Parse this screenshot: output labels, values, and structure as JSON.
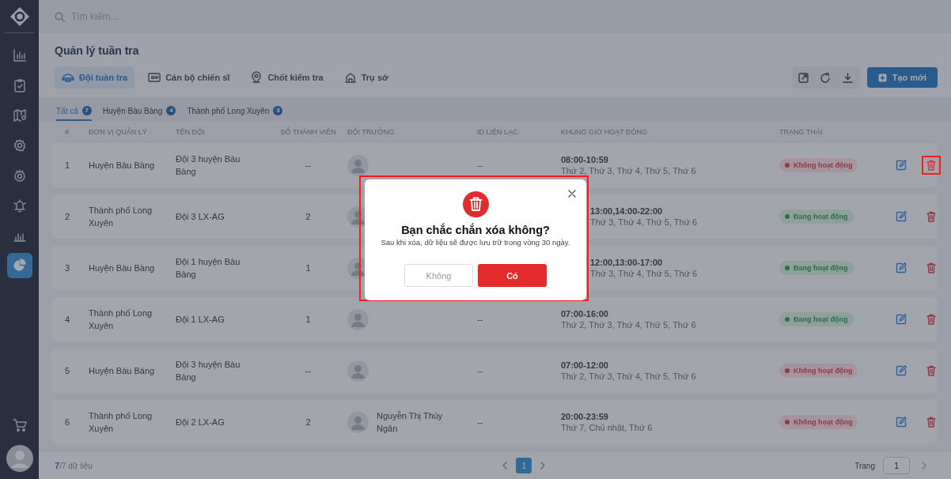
{
  "sidebar": {
    "items": [
      {
        "selected": false
      },
      {
        "selected": false
      },
      {
        "selected": false
      },
      {
        "selected": false
      },
      {
        "selected": false
      },
      {
        "selected": false
      },
      {
        "selected": false
      },
      {
        "selected": true
      }
    ]
  },
  "search": {
    "placeholder": "Tìm kiếm..."
  },
  "page_title": "Quản lý tuần tra",
  "tabs": [
    {
      "label": "Đội tuần tra",
      "selected": true
    },
    {
      "label": "Cán bộ chiến sĩ",
      "selected": false
    },
    {
      "label": "Chốt kiểm tra",
      "selected": false
    },
    {
      "label": "Trụ sở",
      "selected": false
    }
  ],
  "create_button": "Tạo mới",
  "filters": [
    {
      "label": "Tất cả",
      "count": "7",
      "selected": true
    },
    {
      "label": "Huyện Bàu Bàng",
      "count": "4",
      "selected": false
    },
    {
      "label": "Thành phố Long Xuyên",
      "count": "3",
      "selected": false
    }
  ],
  "table": {
    "columns": [
      "#",
      "ĐƠN VỊ QUẢN LÝ",
      "TÊN ĐỘI",
      "SỐ THÀNH VIÊN",
      "ĐỘI TRƯỞNG",
      "ID LIÊN LẠC",
      "KHUNG GIỜ HOẠT ĐỘNG",
      "TRẠNG THÁI"
    ],
    "rows": [
      {
        "index": "1",
        "unit": "Huyện Bàu Bàng",
        "team": "Đội 3 huyện Bàu Bàng",
        "members": "--",
        "contact_id": "--",
        "hours": "08:00-10:59",
        "days": "Thứ 2, Thứ 3, Thứ 4, Thứ 5, Thứ 6",
        "status": "Không hoạt động",
        "active": false,
        "delete_highlighted": true
      },
      {
        "index": "2",
        "unit": "Thành phố Long Xuyên",
        "team": "Đội 3 LX-AG",
        "members": "2",
        "hours": "13:00,14:00-22:00",
        "days": "Thứ 3, Thứ 4, Thứ 5, Thứ 6",
        "status": "Đang hoạt động",
        "active": true,
        "partly_hidden": true
      },
      {
        "index": "3",
        "unit": "Huyện Bàu Bàng",
        "team": "Đội 1 huyện Bàu Bàng",
        "members": "1",
        "hours": "12:00,13:00-17:00",
        "days": "Thứ 3, Thứ 4, Thứ 5, Thứ 6",
        "status": "Đang hoạt động",
        "active": true,
        "partly_hidden": true
      },
      {
        "index": "4",
        "unit": "Thành phố Long Xuyên",
        "team": "Đội 1 LX-AG",
        "members": "1",
        "contact_id": "--",
        "hours": "07:00-16:00",
        "days": "Thứ 2, Thứ 3, Thứ 4, Thứ 5, Thứ 6",
        "status": "Đang hoạt động",
        "active": true
      },
      {
        "index": "5",
        "unit": "Huyện Bàu Bàng",
        "team": "Đội 3 huyện Bàu Bàng",
        "members": "--",
        "contact_id": "--",
        "hours": "07:00-12:00",
        "days": "Thứ 2, Thứ 3, Thứ 4, Thứ 5, Thứ 6",
        "status": "Không hoạt động",
        "active": false
      },
      {
        "index": "6",
        "unit": "Thành phố Long Xuyên",
        "team": "Đội 2 LX-AG",
        "members": "2",
        "leader": "Nguyễn Thị Thúy Ngân",
        "contact_id": "--",
        "hours": "20:00-23:59",
        "days": "Thứ 7, Chủ nhật, Thứ 6",
        "status": "Không hoạt động",
        "active": false
      }
    ]
  },
  "footer": {
    "count": "**7**/7 dữ liệu",
    "pages": [
      {
        "label": "1",
        "selected": true
      }
    ],
    "page_label": "Trang",
    "page_value": "1"
  },
  "dialog": {
    "title": "Bạn chắc chắn xóa không?",
    "message": "Sau khi xóa, dữ liệu sẽ được lưu trữ trong vòng 30 ngày.",
    "cancel": "Không",
    "confirm": "Có",
    "highlighted": true
  }
}
